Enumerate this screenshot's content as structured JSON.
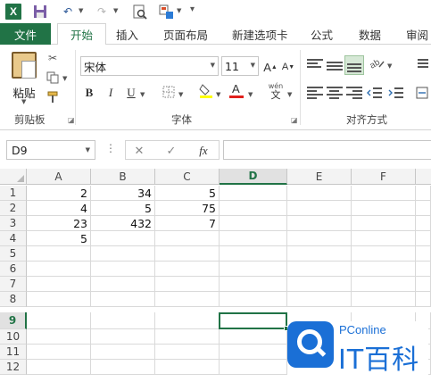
{
  "quick_access": {
    "app_icon": "excel-logo-icon",
    "app_letter": "X",
    "icons": [
      "save-icon",
      "undo-icon",
      "redo-icon",
      "print-preview-icon",
      "customize-icon"
    ]
  },
  "tabs": {
    "file": "文件",
    "items": [
      "开始",
      "插入",
      "页面布局",
      "新建选项卡",
      "公式",
      "数据",
      "审阅"
    ],
    "active": "开始"
  },
  "ribbon": {
    "clipboard": {
      "paste_label": "粘贴",
      "group_label": "剪贴板"
    },
    "font": {
      "font_name": "宋体",
      "font_size": "11",
      "bold": "B",
      "italic": "I",
      "underline": "U",
      "font_color_letter": "A",
      "phonetic_top": "wén",
      "phonetic_letter": "文",
      "increase_font": "A",
      "decrease_font": "A",
      "group_label": "字体"
    },
    "alignment": {
      "group_label": "对齐方式"
    }
  },
  "formula_bar": {
    "name_box": "D9",
    "cancel_symbol": "✕",
    "enter_symbol": "✓",
    "fx_label": "fx",
    "formula": ""
  },
  "sheet": {
    "columns": [
      "A",
      "B",
      "C",
      "D",
      "E",
      "F"
    ],
    "active_column": "D",
    "rows": [
      "1",
      "2",
      "3",
      "4",
      "5",
      "6",
      "7",
      "8",
      "9",
      "10",
      "11",
      "12"
    ],
    "active_row": "9",
    "selected_cell": "D9",
    "cells": [
      [
        "2",
        "34",
        "5"
      ],
      [
        "4",
        "5",
        "75"
      ],
      [
        "23",
        "432",
        "7"
      ],
      [
        "5",
        "",
        ""
      ]
    ]
  },
  "watermark": {
    "brand": "PConline",
    "name": "IT百科"
  },
  "colors": {
    "excel_green": "#217346",
    "watermark_blue": "#1a6fd6"
  }
}
